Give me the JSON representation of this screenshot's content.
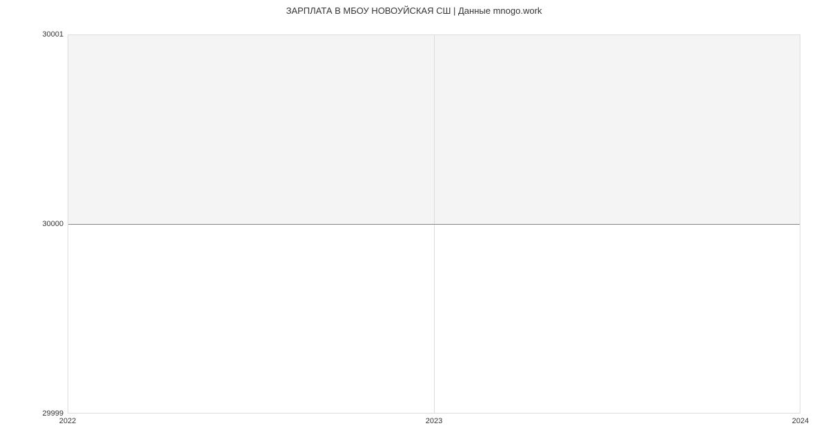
{
  "chart_data": {
    "type": "area",
    "title": "ЗАРПЛАТА В МБОУ НОВОУЙСКАЯ СШ | Данные mnogo.work",
    "x": [
      "2022",
      "2023",
      "2024"
    ],
    "values": [
      30000,
      30000,
      30000
    ],
    "xlabel": "",
    "ylabel": "",
    "xlim": [
      2022,
      2024
    ],
    "ylim": [
      29999,
      30001
    ],
    "y_ticks": [
      29999,
      30000,
      30001
    ],
    "x_ticks": [
      "2022",
      "2023",
      "2024"
    ],
    "line_color": "#4a90e2",
    "fill_color": "#f4f4f4"
  }
}
